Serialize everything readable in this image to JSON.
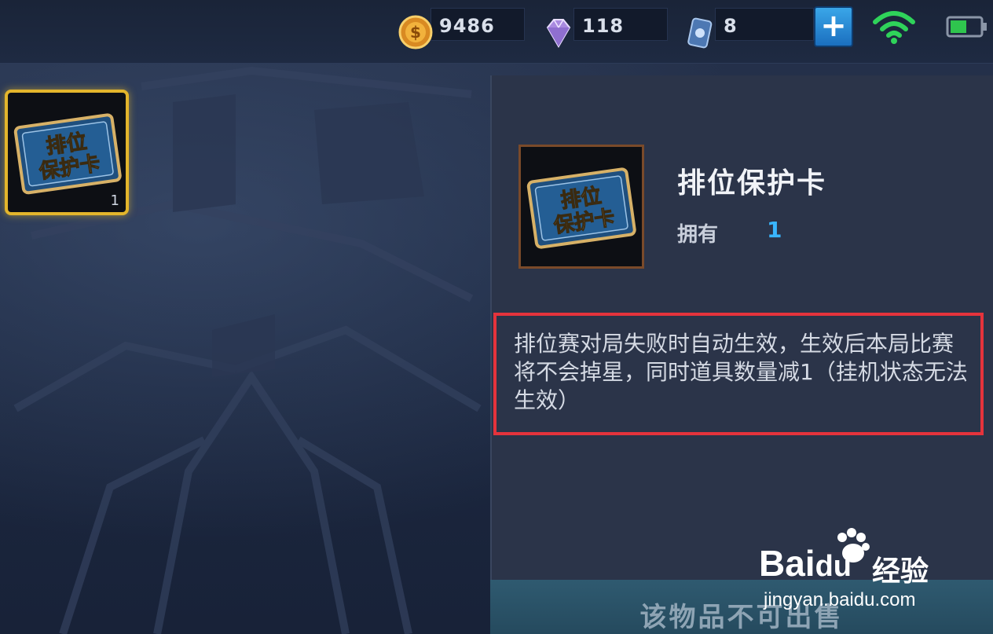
{
  "currencies": [
    {
      "name": "gold-coin",
      "value": "9486",
      "icon": "gold-coin-icon",
      "color": "#e7a235"
    },
    {
      "name": "diamond",
      "value": "118",
      "icon": "diamond-icon",
      "color": "#b79be8"
    },
    {
      "name": "voucher",
      "value": "8",
      "icon": "voucher-icon",
      "color": "#5f8fc9"
    }
  ],
  "topbar": {
    "add_icon": "plus-icon",
    "wifi_icon": "wifi-icon",
    "battery_icon": "battery-icon"
  },
  "inventory": {
    "slot": {
      "label_line1": "排位",
      "label_line2": "保护卡",
      "count": "1"
    }
  },
  "detail": {
    "icon_label_line1": "排位",
    "icon_label_line2": "保护卡",
    "name": "排位保护卡",
    "own_label": "拥有",
    "own_value": "1",
    "description": "排位赛对局失败时自动生效，生效后本局比赛将不会掉星，同时道具数量减1（挂机状态无法生效）",
    "sell_status": "该物品不可出售"
  },
  "watermark": {
    "brand": "Bai",
    "brand2": "du",
    "cn": "经验",
    "url": "jingyan.baidu.com"
  },
  "colors": {
    "highlight_box": "#e5333c",
    "selected_border": "#e3b52c",
    "own_value": "#39b6ff"
  }
}
